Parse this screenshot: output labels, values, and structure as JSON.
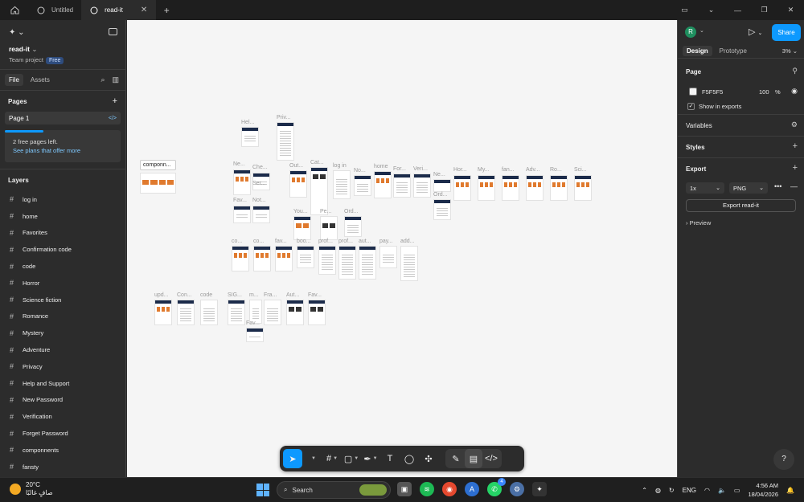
{
  "titlebar": {
    "tabs": [
      {
        "label": "Untitled"
      },
      {
        "label": "read-it"
      }
    ]
  },
  "left": {
    "file_name": "read-it",
    "team": "Team project",
    "plan_badge": "Free",
    "tab_file": "File",
    "tab_assets": "Assets",
    "pages_title": "Pages",
    "current_page": "Page 1",
    "upsell_text": "2 free pages left.",
    "upsell_link": "See plans that offer more",
    "layers_title": "Layers",
    "layers": [
      "log in",
      "home",
      "Favorites",
      "Confirmation code",
      "code",
      "Horror",
      "Science fiction",
      "Romance",
      "Mystery",
      "Adventure",
      "Privacy",
      "Help and Support",
      "New Password",
      "Verification",
      "Forget Password",
      "componnents",
      "fansty"
    ]
  },
  "canvas": {
    "component_label": "componn...",
    "frame_labels": [
      "Hel...",
      "Priv...",
      "Ne...",
      "Che...",
      "Ser...",
      "Out...",
      "Cat...",
      "log in",
      "No...",
      "home",
      "For...",
      "Veri...",
      "Ne...",
      "Hor...",
      "My...",
      "fan...",
      "Adv...",
      "Ro...",
      "Sci...",
      "Ord...",
      "Fav...",
      "Not...",
      "You...",
      "Pe...",
      "Ord...",
      "co...",
      "co...",
      "fav...",
      "boo...",
      "prof...",
      "prof...",
      "aut...",
      "pay...",
      "add...",
      "upd...",
      "Con...",
      "code",
      "SIG...",
      "m...",
      "Fra...",
      "Aut...",
      "Fav...",
      "Fav..."
    ]
  },
  "right": {
    "avatar_letter": "R",
    "share": "Share",
    "tab_design": "Design",
    "tab_prototype": "Prototype",
    "zoom": "3%",
    "page_title": "Page",
    "bg_hex": "F5F5F5",
    "bg_opacity": "100",
    "bg_percent": "%",
    "show_exports": "Show in exports",
    "variables": "Variables",
    "styles": "Styles",
    "export_title": "Export",
    "export_scale": "1x",
    "export_format": "PNG",
    "export_button": "Export read-it",
    "preview": "Preview",
    "help": "?"
  },
  "taskbar": {
    "temperature": "20°C",
    "weather_desc": "صافٍ غالبًا",
    "search": "Search",
    "lang": "ENG",
    "time": "4:56 AM",
    "date": "18/04/2026",
    "whatsapp_badge": "4"
  },
  "colors": {
    "accent": "#0d99ff",
    "canvas_bg": "#f5f5f5",
    "panel_bg": "#2c2c2c",
    "frame_header": "#1b2b4a",
    "book_orange": "#e07a2e"
  }
}
